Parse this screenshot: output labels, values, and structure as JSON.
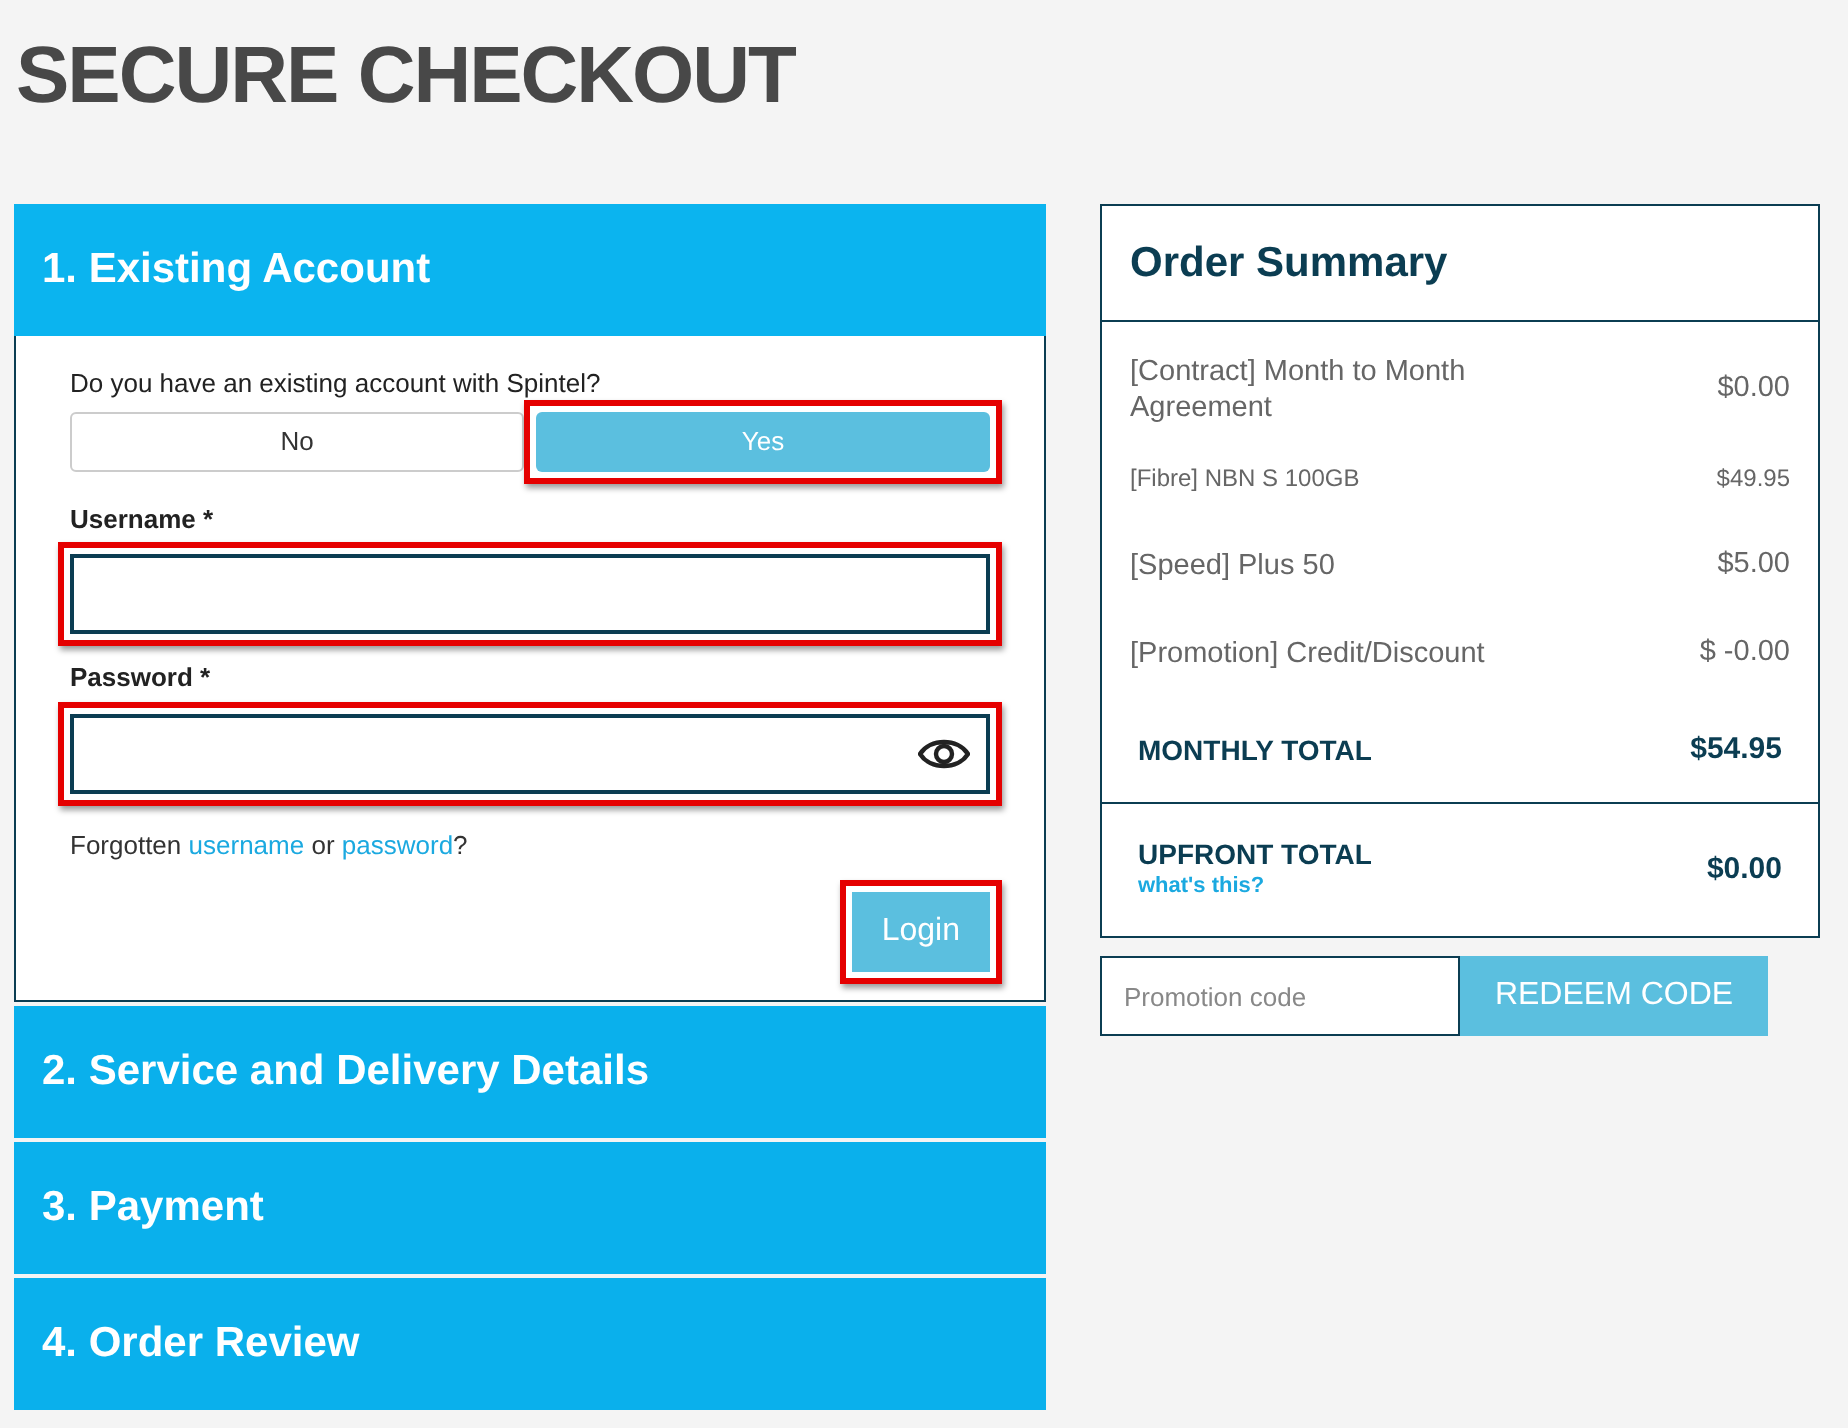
{
  "page_title": "SECURE CHECKOUT",
  "steps": [
    {
      "label": "1. Existing Account",
      "expanded": true
    },
    {
      "label": "2. Service and Delivery Details",
      "expanded": false
    },
    {
      "label": "3. Payment",
      "expanded": false
    },
    {
      "label": "4. Order Review",
      "expanded": false
    }
  ],
  "account_form": {
    "question": "Do you have an existing account with Spintel?",
    "choices": [
      {
        "label": "No",
        "selected": false,
        "highlighted": false
      },
      {
        "label": "Yes",
        "selected": true,
        "highlighted": true
      }
    ],
    "username": {
      "label": "Username *",
      "highlighted": true
    },
    "password": {
      "label": "Password *",
      "highlighted": true
    },
    "forgot": {
      "prefix": "Forgotten",
      "link_1": "username",
      "middle": "or",
      "link_2": "password",
      "suffix": "?"
    },
    "login_button": {
      "label": "Login",
      "highlighted": true
    }
  },
  "order_summary": {
    "title": "Order Summary",
    "items": [
      {
        "label": "[Contract] Month to Month Agreement",
        "price": "$0.00",
        "kind": "normal"
      },
      {
        "label": "[Fibre] NBN S 100GB",
        "price": "$49.95",
        "kind": "small"
      },
      {
        "label": "[Speed] Plus 50",
        "price": "$5.00",
        "kind": "normal"
      },
      {
        "label": "[Promotion] Credit/Discount",
        "price": "$ -0.00",
        "kind": "normal"
      }
    ],
    "monthly_total": {
      "label": "MONTHLY TOTAL",
      "value": "$54.95"
    },
    "upfront_total": {
      "label": "UPFRONT TOTAL",
      "link": "what's this?",
      "value": "$0.00"
    }
  },
  "promo": {
    "placeholder": "Promotion code",
    "button": "REDEEM CODE"
  }
}
